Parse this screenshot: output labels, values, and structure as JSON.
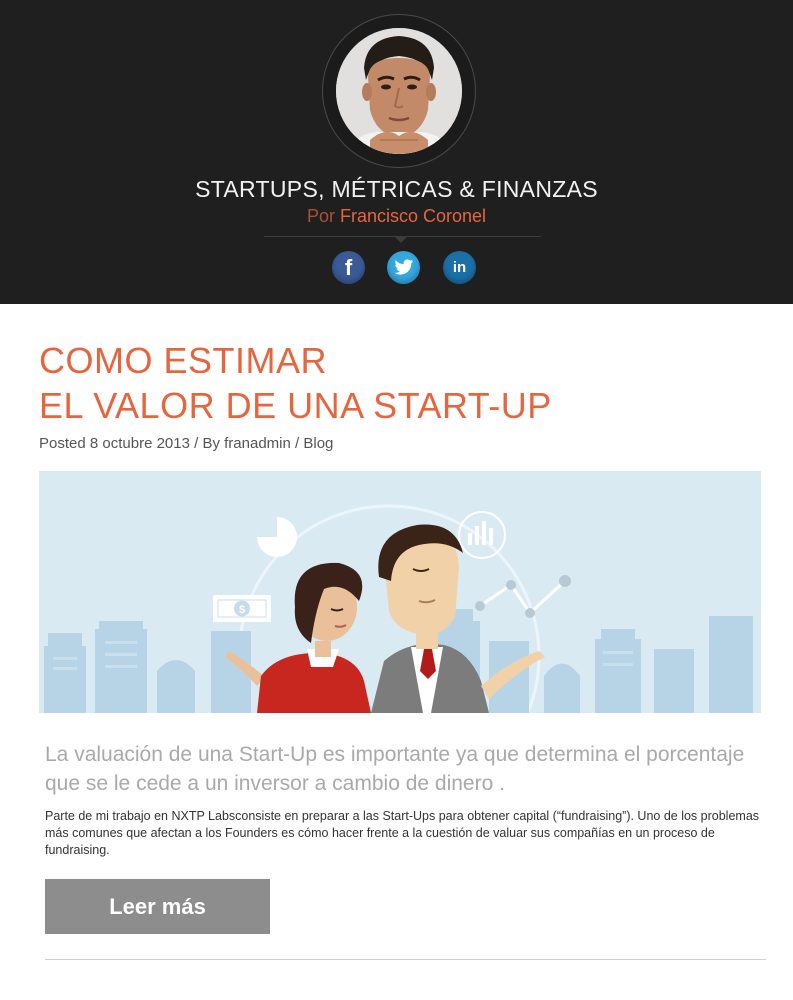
{
  "header": {
    "site_title": "STARTUPS, MÉTRICAS & FINANZAS",
    "byline_prefix": "Por",
    "byline_author": "Francisco Coronel",
    "social": [
      {
        "name": "facebook",
        "glyph": "f",
        "color": "#3b5b98"
      },
      {
        "name": "twitter",
        "glyph": "twitter-bird",
        "color": "#35a8e0"
      },
      {
        "name": "linkedin",
        "glyph": "in",
        "color": "#1c70a8"
      }
    ]
  },
  "post": {
    "title_line1": "COMO ESTIMAR",
    "title_line2": "EL VALOR DE UNA START-UP",
    "meta": {
      "posted_prefix": "Posted",
      "date": "8 octubre 2013",
      "by_sep": "/ By",
      "author": "franadmin",
      "cat_sep": "/",
      "category": "Blog"
    },
    "hero_image": "illustration of woman and man with city skyline, dollar bill and charts",
    "hero_icons": {
      "currency": "$"
    },
    "lead": "La valuación de una Start-Up es importante ya que determina el porcentaje que se le cede a un inversor a cambio de dinero .",
    "excerpt": "Parte de mi trabajo en NXTP Labsconsiste en preparar a las Start-Ups  para obtener capital (“fundraising”). Uno de los problemas más comunes que afectan a los Founders es cómo hacer frente a la cuestión de valuar  sus compañías en un proceso de fundraising.",
    "read_more_label": "Leer más"
  },
  "colors": {
    "header_bg": "#1f1f1f",
    "accent": "#e5663e",
    "button_bg": "#8d8d8d",
    "hero_bg": "#d9eaf3"
  }
}
